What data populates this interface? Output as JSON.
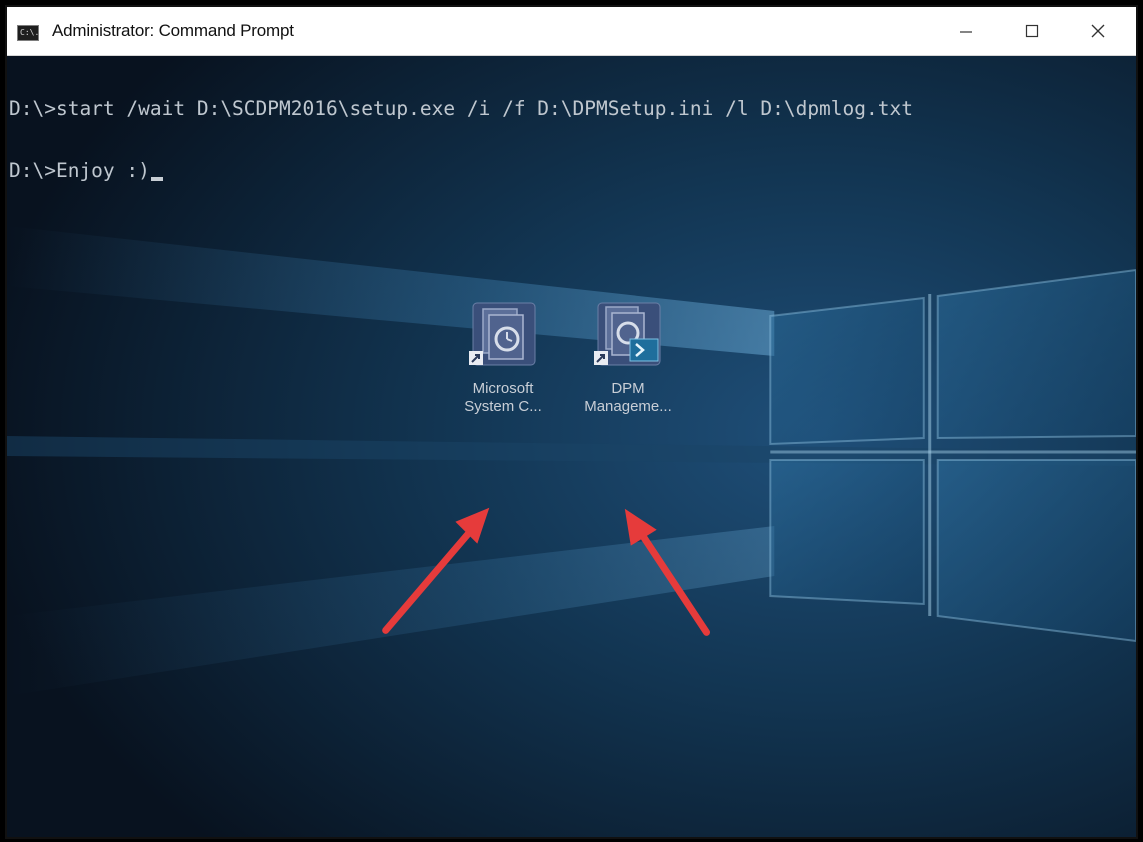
{
  "window": {
    "title": "Administrator: Command Prompt",
    "icon": "cmd-icon",
    "icon_text": "C:\\."
  },
  "controls": {
    "minimize_icon": "minimize-icon",
    "maximize_icon": "maximize-icon",
    "close_icon": "close-icon"
  },
  "console": {
    "lines": [
      "D:\\>start /wait D:\\SCDPM2016\\setup.exe /i /f D:\\DPMSetup.ini /l D:\\dpmlog.txt",
      "D:\\>Enjoy :)"
    ],
    "text_color": "#bfc7cf"
  },
  "desktop": {
    "icons": [
      {
        "label_line1": "Microsoft",
        "label_line2": "System C...",
        "icon": "dpm-console-icon"
      },
      {
        "label_line1": "DPM",
        "label_line2": "Manageme...",
        "icon": "dpm-management-shell-icon"
      }
    ],
    "annotation_color": "#e63b3b"
  }
}
